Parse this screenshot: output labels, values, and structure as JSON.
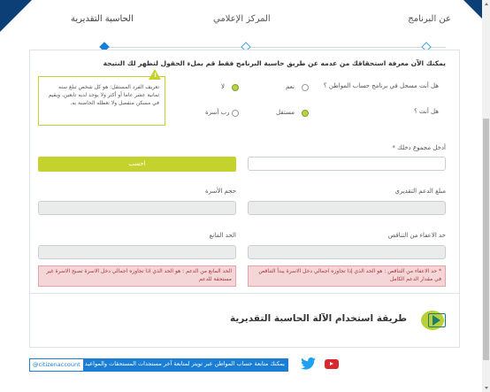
{
  "tabs": [
    {
      "label": "عن البرنامج",
      "active": false
    },
    {
      "label": "المركز الإعلامي",
      "active": false
    },
    {
      "label": "الحاسبة التقديرية",
      "active": true
    }
  ],
  "heading": "يمكنك الآن معرفة استحقاقك من عدمه عن طريق حاسبة البرنامج فقط قم بملء الحقول لتظهر لك النتيجة",
  "note": {
    "icon": "warning-triangle-icon",
    "text": "تعريف الفرد المستقل: هو كل شخص تبلغ سنه ثمانية عشر عاما أو أكثر ولا يوجد لديه تابعين، ويقيم في مسكن منفصل ولا تغطله الحاضنة به."
  },
  "questions": {
    "registered": {
      "label": "هل أنت مسجل في برنامج حساب المواطن ؟",
      "yes": "نعم",
      "no": "لا",
      "selected": "no"
    },
    "status": {
      "label": "هل أنت ؟",
      "independent": "مستقل",
      "head": "رب أسرة",
      "selected": "independent"
    }
  },
  "income": {
    "label": "أدخل مجموع دخلك *",
    "value": ""
  },
  "calculate_label": "احسب",
  "fields": {
    "support_amount": {
      "label": "مبلغ الدعم التقديري",
      "value": ""
    },
    "family_size": {
      "label": "حجم الأسرة",
      "value": ""
    },
    "min_limit": {
      "label": "حد الاعفاء من التناقص",
      "value": ""
    },
    "max_limit": {
      "label": "الحد المانع",
      "value": ""
    }
  },
  "errors": {
    "min": "* حد الاعفاء من التناقص : هو الحد الذي إذا تجاوزه اجمالي دخل الاسرة يبدأ التناقص في مقدار الدعم الكامل",
    "max": "الحد المانع من الدعم : هو الحد الذي اذا تجاوزه اجمالي دخل الاسرة تصبح الاسرة غير مستحقة للدعم"
  },
  "video_title": "طريقة استخدام الآلة الحاسبة التقديرية",
  "social": {
    "text": "يمكنك متابعة حساب المواطن عبر تويتر لمتابعة آخر مستجدات المستحقات والمواعيد",
    "handle": "@citizenaccount"
  },
  "colors": {
    "accent": "#c5d22d",
    "brand": "#0b3f75",
    "link": "#1a7ed4",
    "error_bg": "#f5d6d8"
  }
}
